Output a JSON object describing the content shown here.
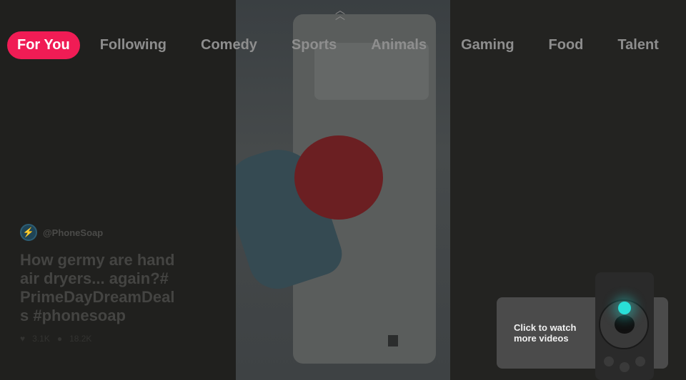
{
  "nav": {
    "up_icon": "double-chevron-up-icon",
    "tabs": [
      {
        "label": "For You",
        "active": true
      },
      {
        "label": "Following"
      },
      {
        "label": "Comedy"
      },
      {
        "label": "Sports"
      },
      {
        "label": "Animals"
      },
      {
        "label": "Gaming"
      },
      {
        "label": "Food"
      },
      {
        "label": "Talent"
      }
    ],
    "accent_color": "#f01c55"
  },
  "video": {
    "author": "@PhoneSoap",
    "title": "How germy are hand air dryers... again?#PrimeDayDreamDeals #phonesoap",
    "likes": "3.1K",
    "comments": "18.2K"
  },
  "tooltip": {
    "text_line1": "Click to watch",
    "text_line2": "more videos",
    "highlight_color": "#29e0d8"
  }
}
